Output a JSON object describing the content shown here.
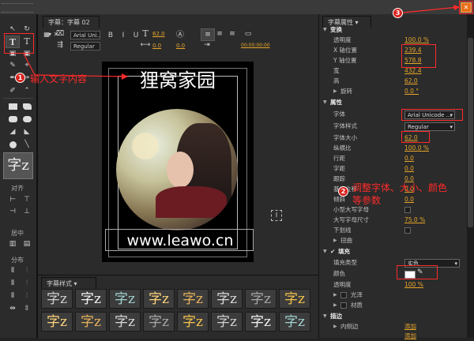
{
  "tabs": {
    "title_panel": "字幕：字幕 02",
    "properties_panel": "字幕属性",
    "styles_panel": "字幕样式"
  },
  "title_toolbar": {
    "font_name": "Arial Uni...",
    "font_style": "Regular",
    "font_size": "62.0",
    "kerning": "0.0",
    "leading": "0.0",
    "time_value": "00:00:00:00"
  },
  "canvas": {
    "main_title": "狸窝家园",
    "url_text": "www.leawo.cn"
  },
  "left_tools": {
    "type_sample": "字z",
    "align_label": "对齐",
    "center_label": "居中",
    "distribute_label": "分布"
  },
  "annotations": {
    "step1_text": "输入文字内容",
    "step2_text": "调整字体、大小、颜色等参数",
    "badges": [
      "1",
      "2",
      "3"
    ]
  },
  "properties": {
    "transform": {
      "header": "变换",
      "rows": [
        {
          "label": "透明度",
          "value": "100.0 %"
        },
        {
          "label": "X 轴位置",
          "value": "239.4"
        },
        {
          "label": "Y 轴位置",
          "value": "578.8"
        },
        {
          "label": "宽",
          "value": "432.4"
        },
        {
          "label": "高",
          "value": "62.0"
        },
        {
          "label": "旋转",
          "value": "0.0 °"
        }
      ]
    },
    "attributes": {
      "header": "属性",
      "font_family_label": "字体",
      "font_family_value": "Arial Unicode ...",
      "font_style_label": "字体样式",
      "font_style_value": "Regular",
      "font_size_label": "字体大小",
      "font_size_value": "62.0",
      "rows": [
        {
          "label": "纵横比",
          "value": "100.0 %"
        },
        {
          "label": "行距",
          "value": "0.0"
        },
        {
          "label": "字距",
          "value": "0.0"
        },
        {
          "label": "跟踪",
          "value": "0.0"
        },
        {
          "label": "基线位移",
          "value": "0.0"
        },
        {
          "label": "倾斜",
          "value": "0.0"
        }
      ],
      "small_caps_label": "小型大写字母",
      "small_caps_size_label": "大写字母尺寸",
      "small_caps_size_value": "75.0 %",
      "underline_label": "下划线",
      "distort_label": "扭曲"
    },
    "fill": {
      "header": "填充",
      "fill_type_label": "填充类型",
      "fill_type_value": "实色",
      "color_label": "颜色",
      "color_value": "#ffffff",
      "opacity_label": "透明度",
      "opacity_value": "100 %",
      "sheen_label": "光泽",
      "texture_label": "材质"
    },
    "stroke": {
      "header": "描边",
      "inner_label": "内侧边",
      "inner_add": "添加",
      "outer_add": "添加"
    }
  },
  "styles": {
    "glyph": "字z",
    "count": 16
  },
  "colors": {
    "accent_value": "#e6a62a",
    "annotation_red": "#ff2a2a",
    "close_button": "#e8701a"
  }
}
